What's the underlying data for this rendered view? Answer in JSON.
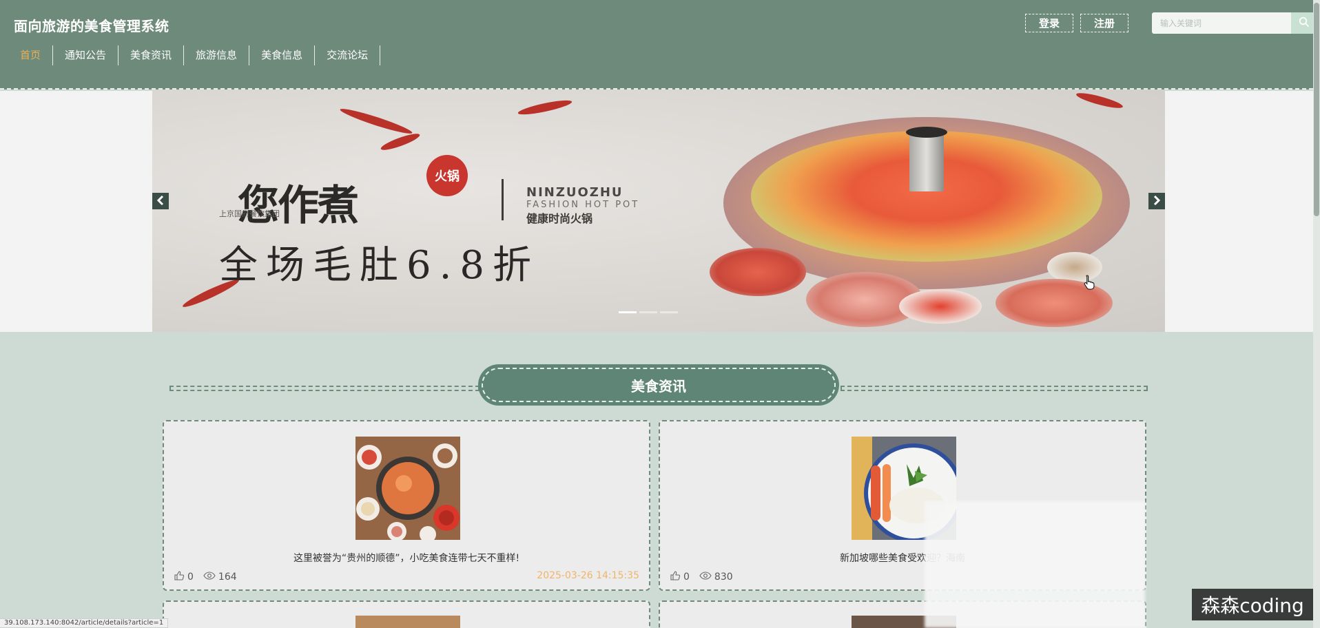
{
  "header": {
    "site_title": "面向旅游的美食管理系统",
    "nav": [
      {
        "label": "首页",
        "active": true
      },
      {
        "label": "通知公告",
        "active": false
      },
      {
        "label": "美食资讯",
        "active": false
      },
      {
        "label": "旅游信息",
        "active": false
      },
      {
        "label": "美食信息",
        "active": false
      },
      {
        "label": "交流论坛",
        "active": false
      }
    ],
    "login_label": "登录",
    "register_label": "注册",
    "search_placeholder": "输入关键词",
    "search_icon": "search-icon"
  },
  "banner": {
    "brand_cn": "您作煮",
    "seal_text": "火锅",
    "brand_sub": "上京国府餐饮集团",
    "brand_en": "NINZUOZHU",
    "brand_en_sub": "FASHION HOT POT",
    "brand_tag": "健康时尚火锅",
    "promo": "全场毛肚6.8折",
    "slide_count": 3,
    "active_slide": 0
  },
  "section": {
    "title": "美食资讯"
  },
  "cards": [
    {
      "title": "这里被誉为“贵州的顺德”，小吃美食连带七天不重样!",
      "likes": "0",
      "views": "164",
      "date": "2025-03-26 14:15:35"
    },
    {
      "title": "新加坡哪些美食受欢迎？海南",
      "likes": "0",
      "views": "830",
      "date": ""
    }
  ],
  "status_url": "39.108.173.140:8042/article/details?article=1",
  "watermark": "森森coding",
  "colors": {
    "header_bg": "#6e8a7b",
    "page_bg": "#cddbd4",
    "accent": "#e8b15a",
    "date": "#f0b46a",
    "section_pill": "#5e8576"
  }
}
